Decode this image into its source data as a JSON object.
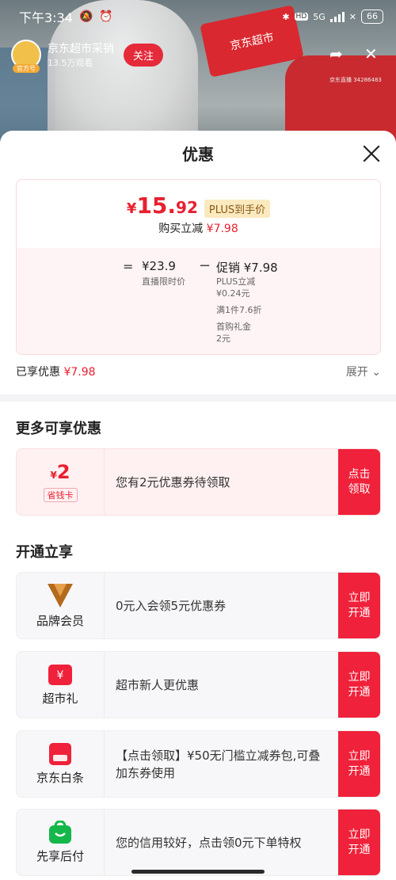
{
  "status_bar": {
    "time": "下午3:34",
    "network": "5G",
    "hd": "HD",
    "battery": "66"
  },
  "live": {
    "host_name": "京东超市采销",
    "views": "13.5万观看",
    "host_tag": "官方号",
    "follow_label": "关注",
    "live_id": "京东直播 34286483",
    "sign_text": "京东超市"
  },
  "sheet": {
    "title": "优惠",
    "price": {
      "yen": "¥",
      "int": "15.",
      "dec": "92",
      "plus_tag": "PLUS到手价",
      "instant_label": "购买立减",
      "instant_value": "¥7.98"
    },
    "breakdown": {
      "equals": "=",
      "base_value": "¥23.9",
      "base_label": "直播限时价",
      "minus": "−",
      "promo_value": "促销 ¥7.98",
      "promo_lines": [
        "PLUS立减",
        "¥0.24元"
      ],
      "promo_line2": "满1件7.6折",
      "promo_lines3": [
        "首购礼金",
        "2元"
      ]
    },
    "enjoyed_label": "已享优惠",
    "enjoyed_value": "¥7.98",
    "expand_label": "展开"
  },
  "more_offers": {
    "title": "更多可享优惠",
    "coupon": {
      "yen": "¥",
      "amount": "2",
      "tag": "省钱卡",
      "text": "您有2元优惠券待领取",
      "button": "点击领取"
    }
  },
  "open_enjoy": {
    "title": "开通立享",
    "items": [
      {
        "icon": "brand-member-icon",
        "label": "品牌会员",
        "text": "0元入会领5元优惠券",
        "button": "立即开通"
      },
      {
        "icon": "supermarket-gift-icon",
        "label": "超市礼",
        "text": "超市新人更优惠",
        "button": "立即开通"
      },
      {
        "icon": "jd-baitiao-icon",
        "label": "京东白条",
        "text": "【点击领取】¥50无门槛立减券包,可叠加东券使用",
        "button": "立即开通"
      },
      {
        "icon": "pay-later-icon",
        "label": "先享后付",
        "text": "您的信用较好，点击领0元下单特权",
        "button": "立即开通"
      }
    ]
  },
  "colors": {
    "accent_red": "#f0213a",
    "price_red": "#e8202f",
    "plus_gold": "#fbe9c0"
  }
}
